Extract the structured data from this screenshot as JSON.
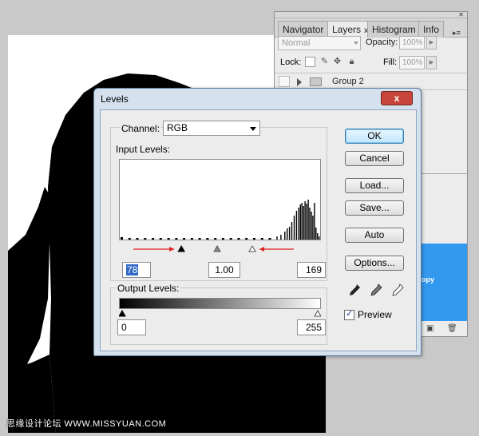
{
  "colors": {
    "dialog_frame": "#d5e1ee",
    "dialog_close": "#c7453a",
    "selected_layer": "#3399ee",
    "annotation_arrow": "#e0201e",
    "text_selection": "#316ac5"
  },
  "watermark": "思缘设计论坛 WWW.MISSYUAN.COM",
  "palette": {
    "tabs": [
      {
        "label": "Navigator",
        "active": false
      },
      {
        "label": "Layers",
        "active": true
      },
      {
        "label": "Histogram",
        "active": false
      },
      {
        "label": "Info",
        "active": false
      }
    ],
    "close_glyph": "x",
    "blend_mode": "Normal",
    "opacity_label": "Opacity:",
    "opacity_value": "100%",
    "lock_label": "Lock:",
    "fill_label": "Fill:",
    "fill_value": "100%",
    "group_name": "Group 2",
    "selected_layer_label": "opy"
  },
  "dialog": {
    "title": "Levels",
    "close_label": "x",
    "channel_label": "Channel:",
    "channel_value": "RGB",
    "input_levels_label": "Input Levels:",
    "input_black": "78",
    "input_gamma": "1.00",
    "input_white": "169",
    "output_levels_label": "Output Levels:",
    "output_black": "0",
    "output_white": "255",
    "buttons": {
      "ok": "OK",
      "cancel": "Cancel",
      "load": "Load...",
      "save": "Save...",
      "auto": "Auto",
      "options": "Options..."
    },
    "preview_label": "Preview",
    "preview_checked": true
  },
  "chart_data": {
    "type": "bar",
    "x_range": [
      0,
      255
    ],
    "ylim": [
      0,
      1
    ],
    "histogram": [
      {
        "x": 0,
        "y": 0.03
      },
      {
        "x": 10,
        "y": 0.02
      },
      {
        "x": 20,
        "y": 0.02
      },
      {
        "x": 30,
        "y": 0.02
      },
      {
        "x": 40,
        "y": 0.02
      },
      {
        "x": 50,
        "y": 0.02
      },
      {
        "x": 60,
        "y": 0.02
      },
      {
        "x": 70,
        "y": 0.02
      },
      {
        "x": 80,
        "y": 0.02
      },
      {
        "x": 90,
        "y": 0.02
      },
      {
        "x": 100,
        "y": 0.02
      },
      {
        "x": 110,
        "y": 0.02
      },
      {
        "x": 120,
        "y": 0.02
      },
      {
        "x": 130,
        "y": 0.02
      },
      {
        "x": 140,
        "y": 0.02
      },
      {
        "x": 150,
        "y": 0.02
      },
      {
        "x": 160,
        "y": 0.02
      },
      {
        "x": 170,
        "y": 0.02
      },
      {
        "x": 180,
        "y": 0.02
      },
      {
        "x": 190,
        "y": 0.02
      },
      {
        "x": 200,
        "y": 0.04
      },
      {
        "x": 205,
        "y": 0.06
      },
      {
        "x": 210,
        "y": 0.1
      },
      {
        "x": 213,
        "y": 0.14
      },
      {
        "x": 216,
        "y": 0.16
      },
      {
        "x": 219,
        "y": 0.22
      },
      {
        "x": 222,
        "y": 0.3
      },
      {
        "x": 225,
        "y": 0.36
      },
      {
        "x": 228,
        "y": 0.4
      },
      {
        "x": 230,
        "y": 0.44
      },
      {
        "x": 232,
        "y": 0.46
      },
      {
        "x": 234,
        "y": 0.42
      },
      {
        "x": 236,
        "y": 0.48
      },
      {
        "x": 238,
        "y": 0.45
      },
      {
        "x": 240,
        "y": 0.5
      },
      {
        "x": 242,
        "y": 0.4
      },
      {
        "x": 244,
        "y": 0.35
      },
      {
        "x": 246,
        "y": 0.3
      },
      {
        "x": 248,
        "y": 0.46
      },
      {
        "x": 250,
        "y": 0.15
      },
      {
        "x": 252,
        "y": 0.08
      },
      {
        "x": 254,
        "y": 0.04
      }
    ],
    "input_black": 78,
    "input_gamma_pos": 124,
    "input_white": 169
  }
}
